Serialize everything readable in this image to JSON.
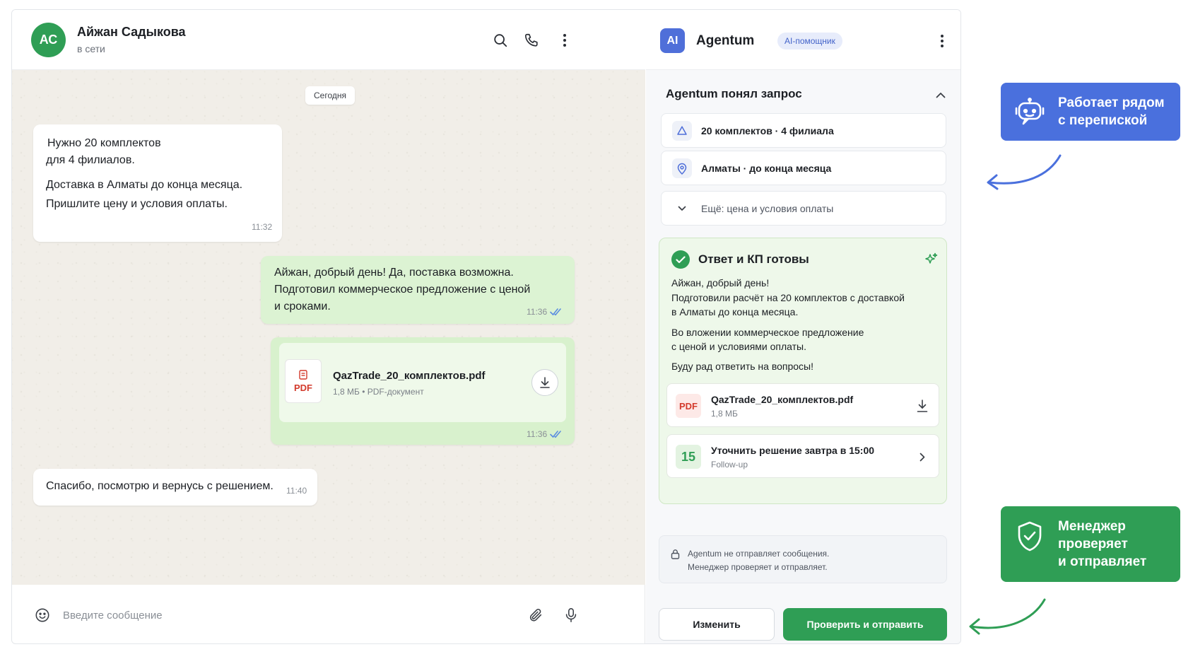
{
  "chat": {
    "contact": {
      "initials": "АС",
      "name": "Айжан Садыкова",
      "status": "в сети"
    },
    "date_chip": "Сегодня",
    "messages": {
      "m1": {
        "line1": "Нужно 20 комплектов",
        "line2": "для 4 филиалов.",
        "line3": "Доставка в Алматы до конца месяца.",
        "line4": "Пришлите цену и условия оплаты.",
        "time": "11:32"
      },
      "m2": {
        "line1": "Айжан, добрый день! Да, поставка возможна.",
        "line2": "Подготовил коммерческое предложение с ценой",
        "line3": "и сроками.",
        "time": "11:36"
      },
      "m3": {
        "file_icon_label": "PDF",
        "file_name": "QazTrade_20_комплектов.pdf",
        "file_meta": "1,8 МБ • PDF-документ",
        "time": "11:36"
      },
      "m4": {
        "text": "Спасибо, посмотрю и вернусь с решением.",
        "time": "11:40"
      }
    },
    "composer": {
      "placeholder": "Введите сообщение"
    }
  },
  "assistant": {
    "badge": "AI",
    "title": "Agentum",
    "tag": "AI-помощник",
    "understood": {
      "title": "Agentum понял запрос",
      "fact1": "20 комплектов · 4 филиала",
      "fact2": "Алматы · до конца месяца",
      "more": "Ещё: цена и условия оплаты"
    },
    "answer": {
      "title": "Ответ и КП готовы",
      "p1_l1": "Айжан, добрый день!",
      "p1_l2": "Подготовили расчёт на 20 комплектов с доставкой",
      "p1_l3": "в Алматы до конца месяца.",
      "p2_l1": "Во вложении коммерческое предложение",
      "p2_l2": "с ценой и условиями оплаты.",
      "p3": "Буду рад ответить на вопросы!",
      "attachment": {
        "icon_label": "PDF",
        "name": "QazTrade_20_комплектов.pdf",
        "size": "1,8 МБ"
      },
      "followup": {
        "day": "15",
        "title": "Уточнить решение завтра в 15:00",
        "subtitle": "Follow-up"
      }
    },
    "notice": {
      "line1": "Agentum не отправляет сообщения.",
      "line2": "Менеджер проверяет и отправляет."
    },
    "buttons": {
      "edit": "Изменить",
      "send": "Проверить и отправить"
    }
  },
  "callouts": {
    "blue": {
      "line1": "Работает рядом",
      "line2": "с перепиской"
    },
    "green": {
      "line1": "Менеджер",
      "line2": "проверяет",
      "line3": "и отправляет"
    }
  },
  "colors": {
    "accent_green": "#2f9e55",
    "accent_blue": "#4a70dd",
    "outgoing_bubble": "#dcf3d3"
  },
  "icons": [
    "search-icon",
    "phone-icon",
    "more-vertical-icon",
    "emoji-icon",
    "paperclip-icon",
    "microphone-icon",
    "download-icon",
    "double-check-icon",
    "bell-icon",
    "location-icon",
    "chevron-down-icon",
    "chevron-up-icon",
    "chevron-right-icon",
    "check-circle-icon",
    "sparkle-icon",
    "lock-icon",
    "robot-icon",
    "shield-check-icon"
  ]
}
